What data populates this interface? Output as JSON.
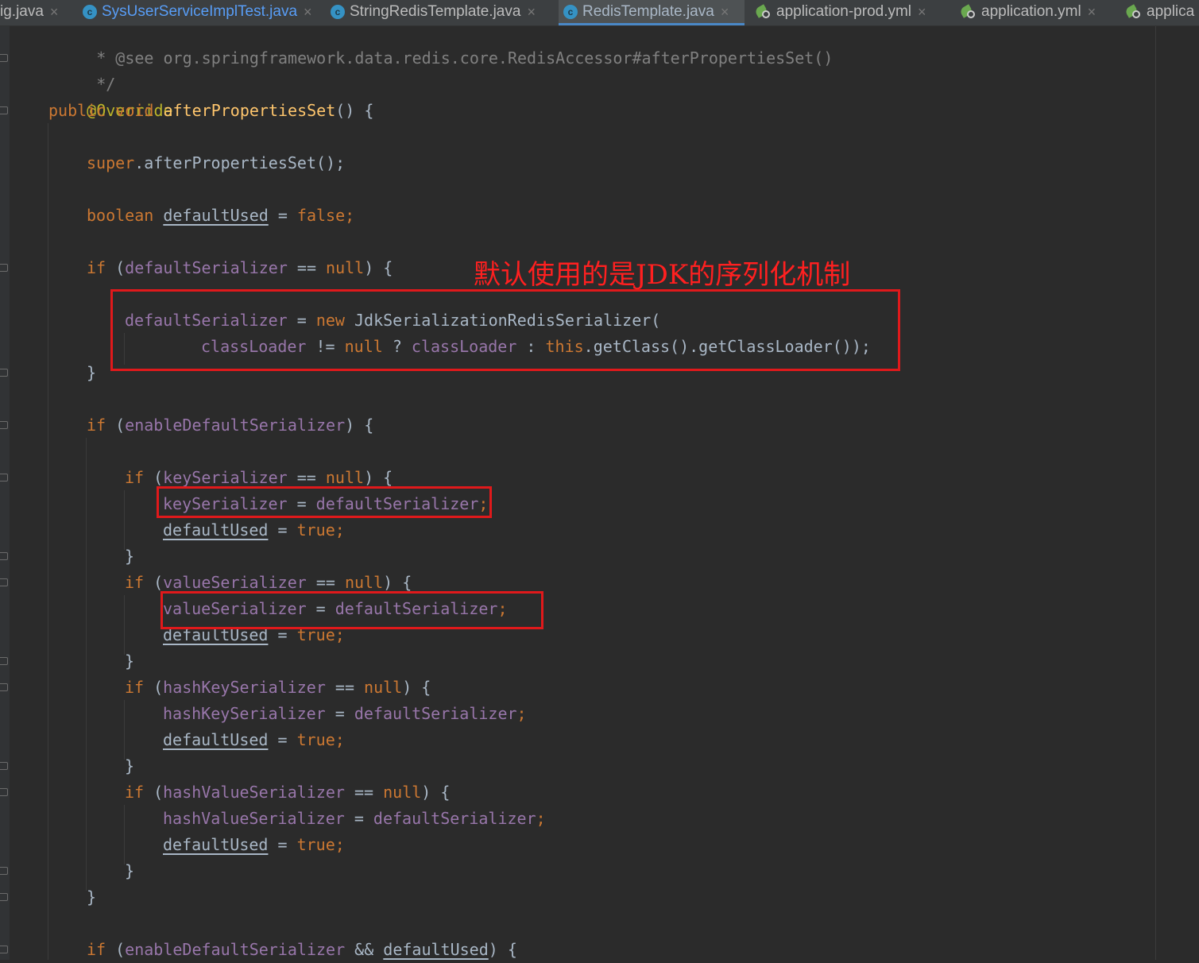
{
  "tabs": [
    {
      "label": "ig.java",
      "icon": "none",
      "active": false
    },
    {
      "label": "SysUserServiceImplTest.java",
      "icon": "java-class-icon",
      "active": false
    },
    {
      "label": "StringRedisTemplate.java",
      "icon": "java-class-icon",
      "active": false
    },
    {
      "label": "RedisTemplate.java",
      "icon": "java-class-icon",
      "active": true
    },
    {
      "label": "application-prod.yml",
      "icon": "spring-yml-icon",
      "active": false
    },
    {
      "label": "application.yml",
      "icon": "spring-yml-icon",
      "active": false
    },
    {
      "label": "applica",
      "icon": "spring-yml-icon",
      "active": false
    }
  ],
  "tab_close_glyph": "×",
  "class_icon_letter": "c",
  "annotation": "默认使用的是JDK的序列化机制",
  "colors": {
    "background": "#2b2b2b",
    "keyword": "#cc7832",
    "field": "#9876aa",
    "annotation": "#bbb529",
    "method": "#ffc66d",
    "comment": "#808080",
    "text": "#a9b7c6",
    "highlight_box": "#e0191b"
  },
  "code": {
    "l1_text": " * @see org.springframework.data.redis.core.RedisAccessor#afterPropertiesSet()",
    "l2_text": " */",
    "l3_ann": "@Override",
    "l4_kw": "public void ",
    "l4_fn": "afterPropertiesSet",
    "l4_rest": "() {",
    "l5_kw": "super",
    "l5_rest": ".afterPropertiesSet();",
    "l6_kw": "boolean ",
    "l6_var": "defaultUsed",
    "l6_eq": " = ",
    "l6_val": "false",
    "l6_end": ";",
    "l7_if": "if ",
    "l7_open": "(",
    "l7_fld": "defaultSerializer",
    "l7_eq": " == ",
    "l7_null": "null",
    "l7_end": ") {",
    "l8_fld": "defaultSerializer",
    "l8_eq": " = ",
    "l8_new": "new ",
    "l8_rest": "JdkSerializationRedisSerializer(",
    "l9_fld": "classLoader",
    "l9_ne": " != ",
    "l9_null": "null",
    "l9_q": " ? ",
    "l9_fld2": "classLoader",
    "l9_c": " : ",
    "l9_this": "this",
    "l9_rest": ".getClass().getClassLoader());",
    "l10": "}",
    "l11_if": "if ",
    "l11_open": "(",
    "l11_fld": "enableDefaultSerializer",
    "l11_end": ") {",
    "l12_if": "if ",
    "l12_open": "(",
    "l12_fld": "keySerializer",
    "l12_eq": " == ",
    "l12_null": "null",
    "l12_end": ") {",
    "l13_fld": "keySerializer",
    "l13_eq": " = ",
    "l13_fld2": "defaultSerializer",
    "l13_end": ";",
    "l14_var": "defaultUsed",
    "l14_eq": " = ",
    "l14_val": "true",
    "l14_end": ";",
    "l15": "}",
    "l16_if": "if ",
    "l16_open": "(",
    "l16_fld": "valueSerializer",
    "l16_eq": " == ",
    "l16_null": "null",
    "l16_end": ") {",
    "l17_fld": "valueSerializer",
    "l17_eq": " = ",
    "l17_fld2": "defaultSerializer",
    "l17_end": ";",
    "l18_var": "defaultUsed",
    "l18_eq": " = ",
    "l18_val": "true",
    "l18_end": ";",
    "l19": "}",
    "l20_if": "if ",
    "l20_open": "(",
    "l20_fld": "hashKeySerializer",
    "l20_eq": " == ",
    "l20_null": "null",
    "l20_end": ") {",
    "l21_fld": "hashKeySerializer",
    "l21_eq": " = ",
    "l21_fld2": "defaultSerializer",
    "l21_end": ";",
    "l22_var": "defaultUsed",
    "l22_eq": " = ",
    "l22_val": "true",
    "l22_end": ";",
    "l23": "}",
    "l24_if": "if ",
    "l24_open": "(",
    "l24_fld": "hashValueSerializer",
    "l24_eq": " == ",
    "l24_null": "null",
    "l24_end": ") {",
    "l25_fld": "hashValueSerializer",
    "l25_eq": " = ",
    "l25_fld2": "defaultSerializer",
    "l25_end": ";",
    "l26_var": "defaultUsed",
    "l26_eq": " = ",
    "l26_val": "true",
    "l26_end": ";",
    "l27": "}",
    "l28": "}",
    "l29_if": "if ",
    "l29_open": "(",
    "l29_fld": "enableDefaultSerializer",
    "l29_and": " && ",
    "l29_var": "defaultUsed",
    "l29_end": ") {"
  }
}
